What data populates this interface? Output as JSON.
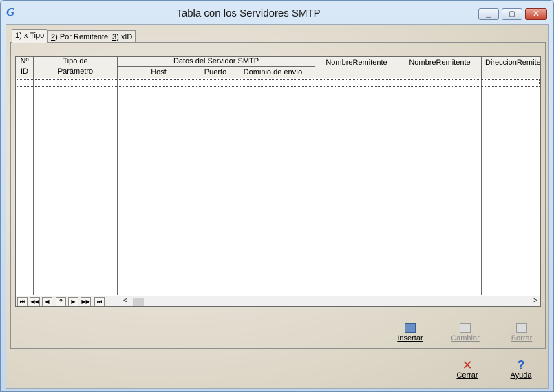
{
  "window": {
    "title": "Tabla con los Servidores SMTP",
    "app_icon": "G",
    "min_glyph": "▁",
    "max_glyph": "▢",
    "close_glyph": "✕"
  },
  "tabs": [
    {
      "key": "1",
      "label": ") x Tipo"
    },
    {
      "key": "2",
      "label": ") Por Remitente"
    },
    {
      "key": "3",
      "label": ") xID"
    }
  ],
  "grid": {
    "headers": {
      "num_top": "Nº",
      "num_bottom": "ID",
      "tipo_top": "Tipo de",
      "tipo_bottom": "Parámetro",
      "group": "Datos del Servidor SMTP",
      "host": "Host",
      "puerto": "Puerto",
      "dominio": "Dominio de envío",
      "nombre1": "NombreRemitente",
      "nombre2": "NombreRemitente",
      "direccion": "DireccionRemiter"
    },
    "nav": [
      "⏮",
      "◀◀",
      "◀",
      "?",
      "▶",
      "▶▶",
      "⏭"
    ],
    "scroll_left": "<",
    "scroll_right": ">"
  },
  "actions": {
    "insertar": {
      "label": "Insertar",
      "icon": "insert-icon"
    },
    "cambiar": {
      "label": "Cambiar",
      "icon": "edit-icon"
    },
    "borrar": {
      "label": "Borrar",
      "icon": "delete-icon"
    },
    "cerrar": {
      "label": "Cerrar",
      "icon": "close-x-icon",
      "glyph": "✕"
    },
    "ayuda": {
      "label": "Ayuda",
      "icon": "help-icon",
      "glyph": "?"
    }
  },
  "colors": {
    "close_red": "#c5332a",
    "help_blue": "#2a64c6",
    "disabled_gray": "#8c8c8c"
  }
}
